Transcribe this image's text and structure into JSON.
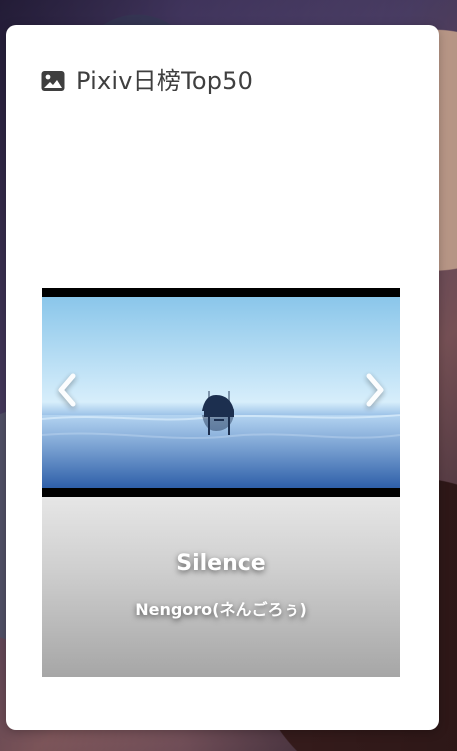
{
  "card": {
    "title": "Pixiv日榜Top50",
    "header_icon": "image-icon"
  },
  "carousel": {
    "current": {
      "title": "Silence",
      "author": "Nengoro(ネんごろぅ)"
    },
    "controls": {
      "prev_icon": "chevron-left-icon",
      "next_icon": "chevron-right-icon"
    }
  },
  "colors": {
    "card_bg": "#ffffff",
    "text_dark": "#3f3f3f",
    "caption_text": "#ffffff"
  }
}
